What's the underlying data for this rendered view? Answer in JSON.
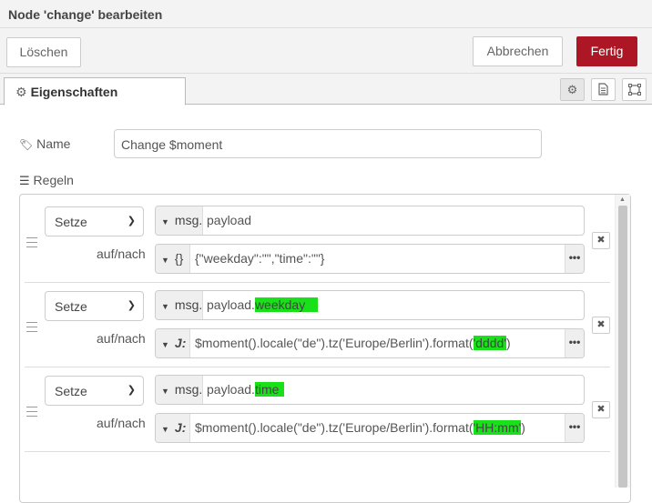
{
  "title": "Node 'change' bearbeiten",
  "toolbar": {
    "delete_label": "Löschen",
    "cancel_label": "Abbrechen",
    "done_label": "Fertig",
    "done_color": "#ad1625"
  },
  "tabs": {
    "properties_label": "Eigenschaften",
    "properties_icon": "gear-icon"
  },
  "tab_icons": [
    "gear-icon",
    "description-icon",
    "appearance-icon"
  ],
  "form": {
    "name_label": "Name",
    "name_value": "Change $moment",
    "rules_label": "Regeln"
  },
  "rules": [
    {
      "action": "Setze",
      "target_type": "msg.",
      "target_value": "payload",
      "target_highlight": "",
      "to_label": "auf/nach",
      "source_type_icon": "{}",
      "source_prefix": "{\"weekday\":\"\",\"time\":\"\"}",
      "source_highlight": "",
      "source_suffix": ""
    },
    {
      "action": "Setze",
      "target_type": "msg.",
      "target_value": "payload.",
      "target_highlight": "weekday   ",
      "to_label": "auf/nach",
      "source_type_icon": "J:",
      "source_prefix": "$moment().locale(\"de\").tz('Europe/Berlin').format(",
      "source_highlight": "'dddd'",
      "source_suffix": ")"
    },
    {
      "action": "Setze",
      "target_type": "msg.",
      "target_value": "payload.",
      "target_highlight": "time  ",
      "to_label": "auf/nach",
      "source_type_icon": "J:",
      "source_prefix": "$moment().locale(\"de\").tz('Europe/Berlin').format(",
      "source_highlight": "'HH:mm'",
      "source_suffix": ")"
    }
  ],
  "highlight_color": "#19e119"
}
